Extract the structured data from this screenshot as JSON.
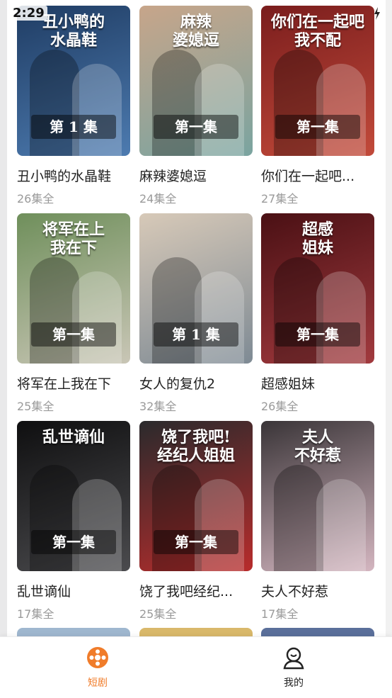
{
  "status_bar": {
    "time": "2:29"
  },
  "dramas": [
    {
      "title": "丑小鸭的水晶鞋",
      "episodes": "26集全",
      "cover_title": "丑小鸭的\n水晶鞋",
      "cover_episode": "第 1 集",
      "colors": [
        "#1f3c63",
        "#4d7bb0"
      ]
    },
    {
      "title": "麻辣婆媳逗",
      "episodes": "24集全",
      "cover_title": "麻辣\n婆媳逗",
      "cover_episode": "第一集",
      "colors": [
        "#c7a58a",
        "#7aa4a0"
      ]
    },
    {
      "title": "你们在一起吧...",
      "episodes": "27集全",
      "cover_title": "你们在一起吧\n我不配",
      "cover_episode": "第一集",
      "colors": [
        "#7a1d1d",
        "#c24a3a"
      ]
    },
    {
      "title": "将军在上我在下",
      "episodes": "25集全",
      "cover_title": "将军在上\n我在下",
      "cover_episode": "第一集",
      "colors": [
        "#6f8f5b",
        "#c9c6b6"
      ]
    },
    {
      "title": "女人的复仇2",
      "episodes": "32集全",
      "cover_title": "",
      "cover_episode": "第 1 集",
      "colors": [
        "#d7c9b8",
        "#7e8a94"
      ]
    },
    {
      "title": "超感姐妹",
      "episodes": "26集全",
      "cover_title": "超感\n姐妹",
      "cover_episode": "第一集",
      "colors": [
        "#4a1014",
        "#a23a3e"
      ]
    },
    {
      "title": "乱世谪仙",
      "episodes": "17集全",
      "cover_title": "乱世谪仙",
      "cover_episode": "第一集",
      "colors": [
        "#0f0f10",
        "#4b4b4e"
      ]
    },
    {
      "title": "饶了我吧经纪...",
      "episodes": "25集全",
      "cover_title": "饶了我吧!\n经纪人姐姐",
      "cover_episode": "第一集",
      "colors": [
        "#2a2a2c",
        "#b82c2c"
      ]
    },
    {
      "title": "夫人不好惹",
      "episodes": "17集全",
      "cover_title": "夫人\n不好惹",
      "cover_episode": "",
      "colors": [
        "#3a3538",
        "#d4b6c0"
      ]
    }
  ],
  "tabbar": {
    "items": [
      {
        "label": "短剧",
        "icon": "film-reel-icon",
        "active": true
      },
      {
        "label": "我的",
        "icon": "user-icon",
        "active": false
      }
    ],
    "active_color": "#f07c2a",
    "inactive_color": "#222222"
  }
}
